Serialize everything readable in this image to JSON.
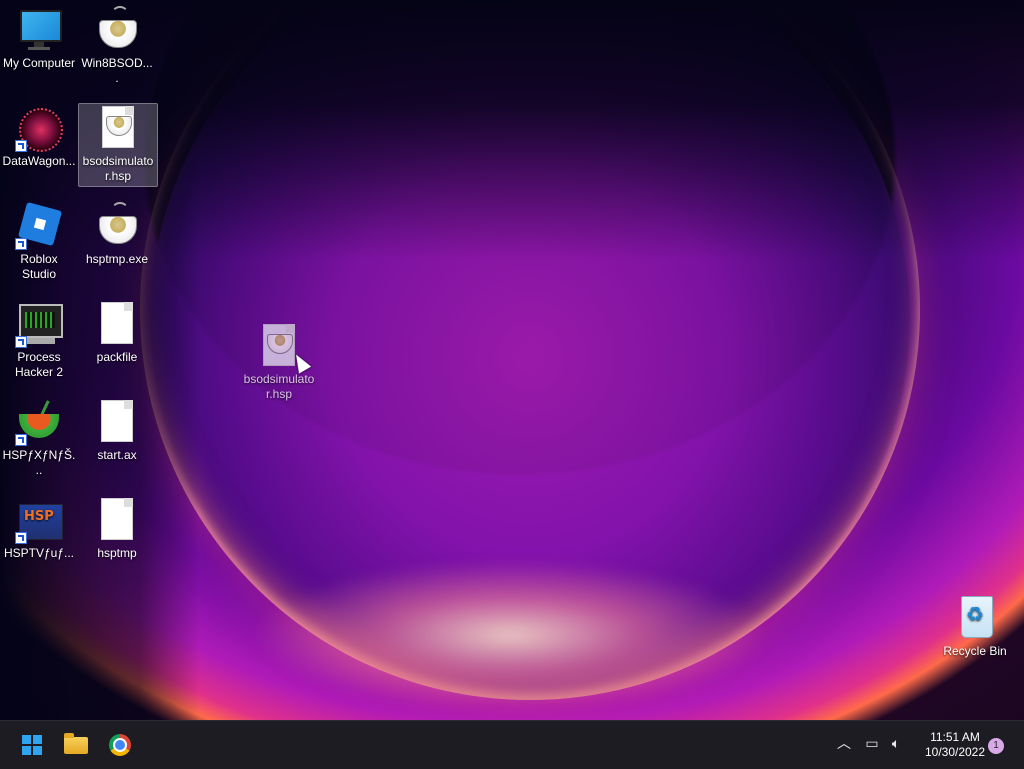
{
  "desktop": {
    "icons": [
      {
        "label": "My Computer",
        "icon": "monitor-icon"
      },
      {
        "label": "Win8BSOD....",
        "icon": "hsp-cup-icon"
      },
      {
        "label": "DataWagon...",
        "icon": "datawagon-icon"
      },
      {
        "label": "bsodsimulator.hsp",
        "icon": "hsp-file-icon"
      },
      {
        "label": "Roblox Studio",
        "icon": "roblox-icon"
      },
      {
        "label": "hsptmp.exe",
        "icon": "hsp-cup-icon"
      },
      {
        "label": "Process Hacker 2",
        "icon": "process-hacker-icon"
      },
      {
        "label": "packfile",
        "icon": "blank-file-icon"
      },
      {
        "label": "HSPƒXƒNƒŠ...",
        "icon": "hsp-bowl-icon"
      },
      {
        "label": "start.ax",
        "icon": "blank-file-icon"
      },
      {
        "label": "HSPTVƒuƒ...",
        "icon": "hsptv-icon"
      },
      {
        "label": "hsptmp",
        "icon": "blank-file-icon"
      },
      {
        "label": "Recycle Bin",
        "icon": "recycle-bin-icon"
      }
    ],
    "drag_ghost": {
      "label": "bsodsimulator.hsp",
      "icon": "hsp-file-icon"
    }
  },
  "taskbar": {
    "pinned": [
      {
        "name": "Start",
        "icon": "windows-logo-icon"
      },
      {
        "name": "File Explorer",
        "icon": "folder-icon"
      },
      {
        "name": "Google Chrome",
        "icon": "chrome-icon"
      }
    ],
    "tray": {
      "icons": [
        "chevron-up-icon",
        "network-icon",
        "volume-icon"
      ],
      "time": "11:51 AM",
      "date": "10/30/2022",
      "notification_count": "1"
    }
  },
  "colors": {
    "taskbar_bg": "#1c1c22",
    "accent": "#2fa4f0",
    "selection": "rgba(255,255,255,0.22)"
  }
}
